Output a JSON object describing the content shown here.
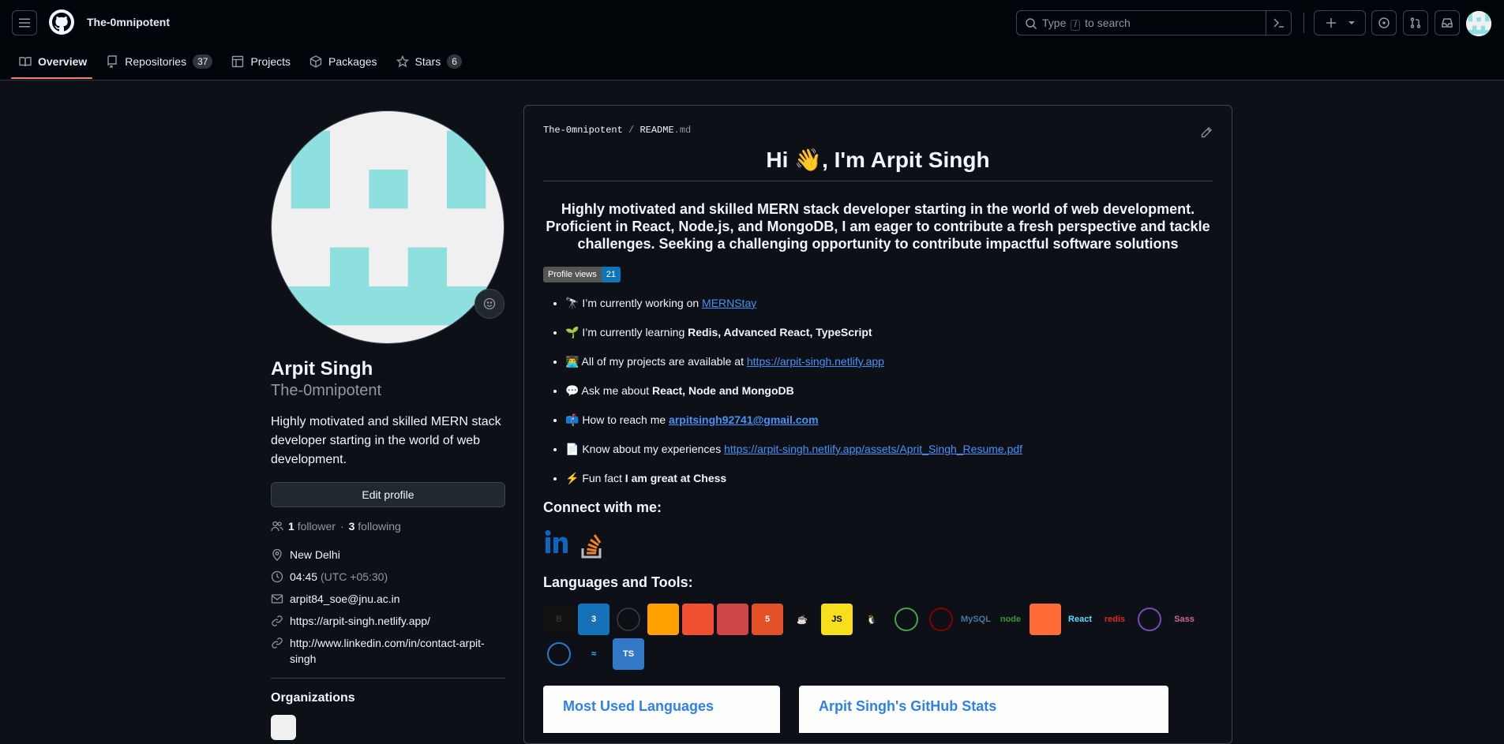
{
  "header": {
    "owner": "The-0mnipotent",
    "search": {
      "pre": "Type",
      "key": "/",
      "post": "to search"
    }
  },
  "tabs": [
    {
      "label": "Overview"
    },
    {
      "label": "Repositories",
      "count": "37"
    },
    {
      "label": "Projects"
    },
    {
      "label": "Packages"
    },
    {
      "label": "Stars",
      "count": "6"
    }
  ],
  "profile": {
    "name": "Arpit Singh",
    "login": "The-0mnipotent",
    "bio": "Highly motivated and skilled MERN stack developer starting in the world of web development.",
    "edit_label": "Edit profile",
    "followers": "1",
    "followers_label": "follower",
    "following": "3",
    "following_label": "following",
    "location": "New Delhi",
    "time": "04:45",
    "timezone": "(UTC +05:30)",
    "email": "arpit84_soe@jnu.ac.in",
    "website": "https://arpit-singh.netlify.app/",
    "linkedin": "http://www.linkedin.com/in/contact-arpit-singh",
    "organizations_label": "Organizations"
  },
  "readme": {
    "path_owner": "The-0mnipotent",
    "path_file": "README",
    "path_ext": ".md",
    "title": "Hi 👋, I'm Arpit Singh",
    "subtitle": "Highly motivated and skilled MERN stack developer starting in the world of web development. Proficient in React, Node.js, and MongoDB, I am eager to contribute a fresh perspective and tackle challenges. Seeking a challenging opportunity to contribute impactful software solutions",
    "badge_label": "Profile views",
    "badge_value": "21",
    "items": [
      {
        "prefix": "🔭 I’m currently working on ",
        "link": "MERNStay"
      },
      {
        "prefix": "🌱 I’m currently learning ",
        "bold": "Redis, Advanced React, TypeScript"
      },
      {
        "prefix": "👨‍💻 All of my projects are available at ",
        "link": "https://arpit-singh.netlify.app"
      },
      {
        "prefix": "💬 Ask me about ",
        "bold": "React, Node and MongoDB"
      },
      {
        "prefix": "📫 How to reach me ",
        "link": "arpitsingh92741@gmail.com"
      },
      {
        "prefix": "📄 Know about my experiences ",
        "link": "https://arpit-singh.netlify.app/assets/Aprit_Singh_Resume.pdf"
      },
      {
        "prefix": "⚡ Fun fact ",
        "bold": "I am great at Chess"
      }
    ],
    "connect_heading": "Connect with me:",
    "tools_heading": "Languages and Tools:",
    "tools": [
      {
        "name": "bootstrap",
        "text": "B",
        "bg": "#111111",
        "fg": "#333333"
      },
      {
        "name": "css3",
        "text": "3",
        "bg": "#1572b6",
        "fg": "#ffffff"
      },
      {
        "name": "express",
        "text": "",
        "bg": "transparent",
        "fg": "#333333"
      },
      {
        "name": "firebase",
        "text": "",
        "bg": "#ffa000",
        "fg": "#ffffff"
      },
      {
        "name": "git",
        "text": "",
        "bg": "#f05032",
        "fg": "#ffffff"
      },
      {
        "name": "gulp",
        "text": "",
        "bg": "#cf4647",
        "fg": "#ffffff"
      },
      {
        "name": "html5",
        "text": "5",
        "bg": "#e34f26",
        "fg": "#ffffff"
      },
      {
        "name": "java",
        "text": "☕",
        "bg": "transparent",
        "fg": "#e76f00"
      },
      {
        "name": "javascript",
        "text": "JS",
        "bg": "#f7df1e",
        "fg": "#000000"
      },
      {
        "name": "linux",
        "text": "🐧",
        "bg": "transparent",
        "fg": "#ffffff"
      },
      {
        "name": "mongodb",
        "text": "",
        "bg": "transparent",
        "fg": "#47a248"
      },
      {
        "name": "mongoose",
        "text": "",
        "bg": "transparent",
        "fg": "#880000"
      },
      {
        "name": "mysql",
        "text": "MySQL",
        "bg": "transparent",
        "fg": "#4479a1"
      },
      {
        "name": "nodejs",
        "text": "node",
        "bg": "transparent",
        "fg": "#339933"
      },
      {
        "name": "postman",
        "text": "",
        "bg": "#ff6c37",
        "fg": "#ffffff"
      },
      {
        "name": "react",
        "text": "React",
        "bg": "transparent",
        "fg": "#61dafb"
      },
      {
        "name": "redis",
        "text": "redis",
        "bg": "transparent",
        "fg": "#d82c20"
      },
      {
        "name": "redux",
        "text": "",
        "bg": "transparent",
        "fg": "#764abc"
      },
      {
        "name": "sass",
        "text": "Sass",
        "bg": "transparent",
        "fg": "#cc6699"
      },
      {
        "name": "swift",
        "text": "",
        "bg": "transparent",
        "fg": "#2d79c7"
      },
      {
        "name": "tailwind",
        "text": "≈",
        "bg": "transparent",
        "fg": "#38bdf8"
      },
      {
        "name": "typescript",
        "text": "TS",
        "bg": "#3178c6",
        "fg": "#ffffff"
      }
    ],
    "card_langs": "Most Used Languages",
    "card_stats": "Arpit Singh's GitHub Stats"
  }
}
